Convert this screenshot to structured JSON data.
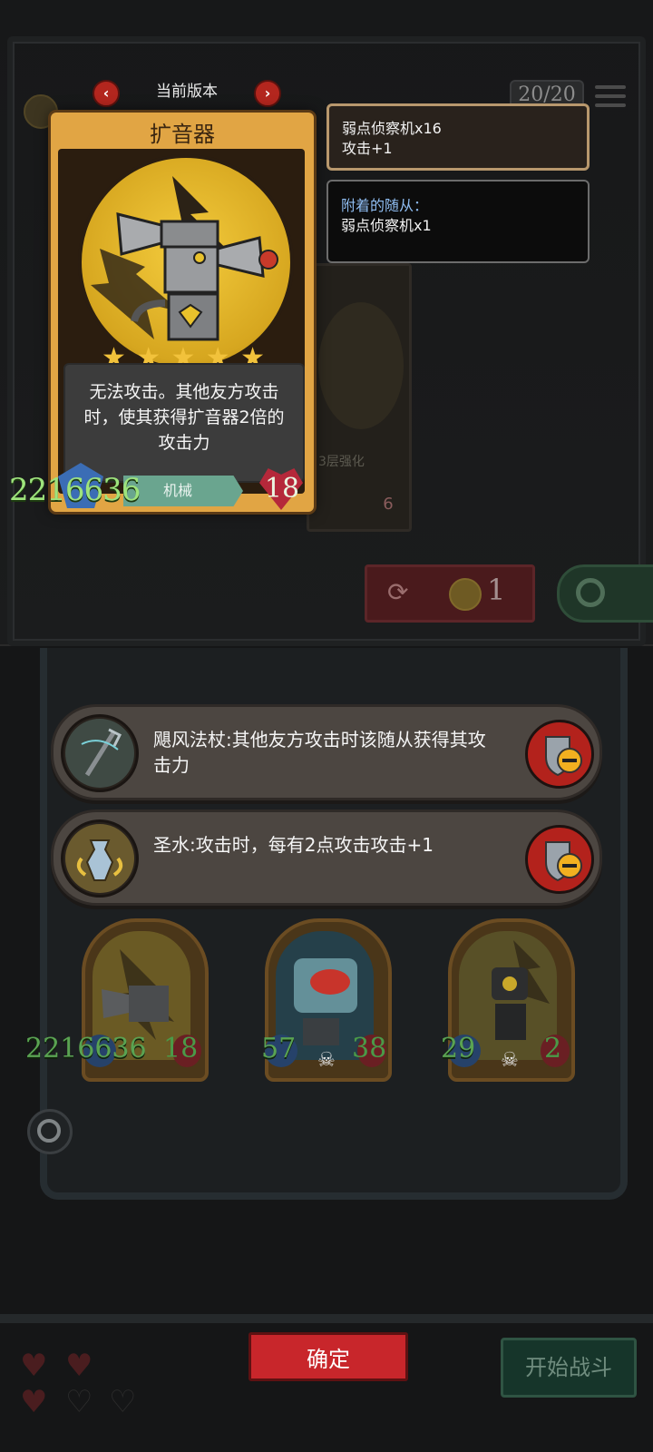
{
  "header": {
    "version_title": "当前版本",
    "prev_label": "‹",
    "next_label": "›",
    "slot_counter": "20/20"
  },
  "detail_card": {
    "name": "扩音器",
    "stars": 5,
    "star_glyph": "★",
    "description": "无法攻击。其他友方攻击时，使其获得扩音器2倍的攻击力",
    "tribe": "机械",
    "attack": "2216636",
    "health": "18"
  },
  "background_card": {
    "enhance_label": "3层强化",
    "health": "6"
  },
  "refresh": {
    "cost": "1"
  },
  "info": {
    "line1": "弱点侦察机x16",
    "line2": "攻击+1",
    "attached_header": "附着的随从：",
    "attached_item": "弱点侦察机x1"
  },
  "items": [
    {
      "icon": "staff-icon",
      "text": "飓风法杖:其他友方攻击时该随从获得其攻击力"
    },
    {
      "icon": "holy-water-icon",
      "text": "圣水:攻击时，每有2点攻击攻击+1"
    }
  ],
  "units": [
    {
      "name": "amplifier",
      "attack": "2216636",
      "health": "18"
    },
    {
      "name": "fish-robot",
      "attack": "57",
      "health": "38"
    },
    {
      "name": "recon-robot",
      "attack": "29",
      "health": "2"
    }
  ],
  "buttons": {
    "confirm": "确定",
    "start_battle": "开始战斗"
  },
  "colors": {
    "card_gold": "#e1a544",
    "attack_green": "#9ee37c",
    "health_red": "#b5283a",
    "confirm_red": "#c8262b",
    "info_blue": "#8fbdf2"
  }
}
